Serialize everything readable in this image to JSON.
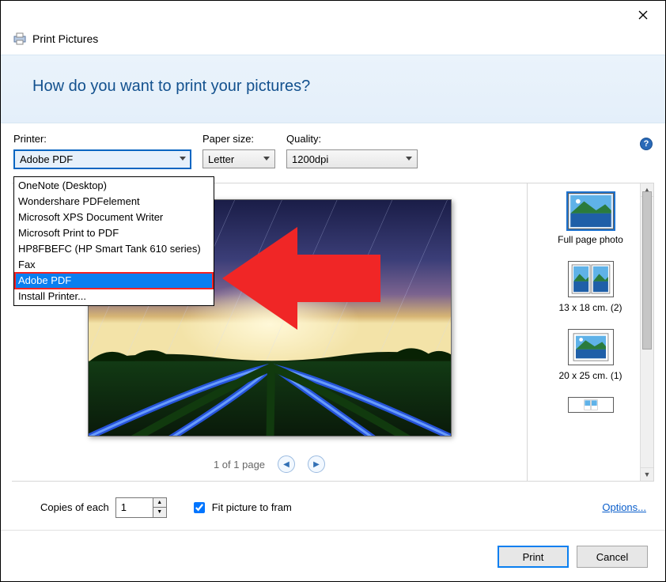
{
  "window_title": "Print Pictures",
  "heading": "How do you want to print your pictures?",
  "printer": {
    "label": "Printer:",
    "selected": "Adobe PDF",
    "options": [
      "OneNote (Desktop)",
      "Wondershare PDFelement",
      "Microsoft XPS Document Writer",
      "Microsoft Print to PDF",
      "HP8FBEFC (HP Smart Tank 610 series)",
      "Fax",
      "Adobe PDF",
      "Install Printer..."
    ]
  },
  "paper_size": {
    "label": "Paper size:",
    "selected": "Letter"
  },
  "quality": {
    "label": "Quality:",
    "selected": "1200dpi"
  },
  "page_status": "1 of 1 page",
  "layouts": [
    {
      "label": "Full page photo",
      "selected": true
    },
    {
      "label": "13 x 18 cm. (2)",
      "selected": false
    },
    {
      "label": "20 x 25 cm. (1)",
      "selected": false
    },
    {
      "label": "",
      "selected": false
    }
  ],
  "copies": {
    "label": "Copies of each",
    "value": "1"
  },
  "fit": {
    "label": "Fit picture to fram",
    "checked": true
  },
  "options_link": "Options...",
  "buttons": {
    "print": "Print",
    "cancel": "Cancel"
  }
}
